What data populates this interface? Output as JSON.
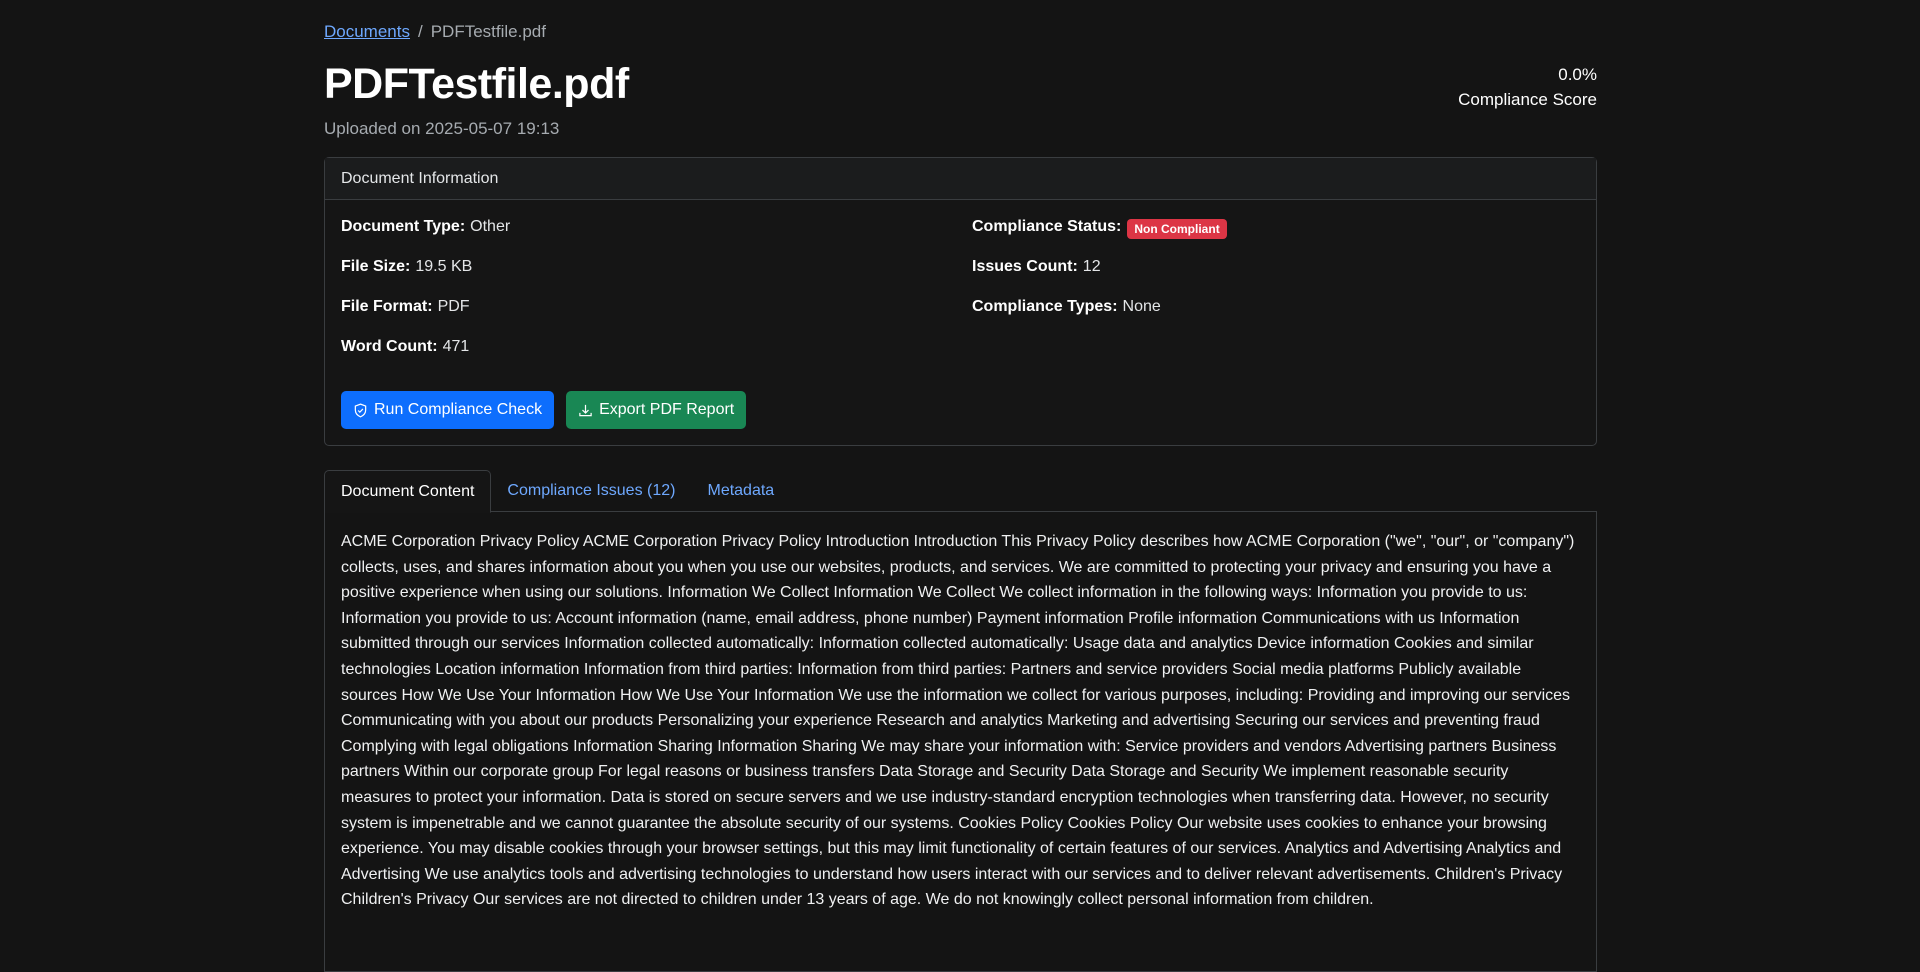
{
  "breadcrumb": {
    "parent": "Documents",
    "separator": "/",
    "current": "PDFTestfile.pdf"
  },
  "document": {
    "title": "PDFTestfile.pdf",
    "uploaded": "Uploaded on 2025-05-07 19:13"
  },
  "score": {
    "value": "0.0%",
    "label": "Compliance Score"
  },
  "info_card": {
    "header": "Document Information",
    "left": [
      {
        "label": "Document Type:",
        "value": "Other"
      },
      {
        "label": "File Size:",
        "value": "19.5 KB"
      },
      {
        "label": "File Format:",
        "value": "PDF"
      },
      {
        "label": "Word Count:",
        "value": "471"
      }
    ],
    "right": [
      {
        "label": "Compliance Status:",
        "value": "Non Compliant"
      },
      {
        "label": "Issues Count:",
        "value": "12"
      },
      {
        "label": "Compliance Types:",
        "value": "None"
      }
    ],
    "status_color": "#dc3545"
  },
  "actions": {
    "run_check": "Run Compliance Check",
    "run_check_icon": "shield-check-icon",
    "export": "Export PDF Report",
    "export_icon": "download-icon"
  },
  "tabs": [
    {
      "label": "Document Content",
      "active": true
    },
    {
      "label": "Compliance Issues (12)",
      "active": false
    },
    {
      "label": "Metadata",
      "active": false
    }
  ],
  "content_text": "ACME Corporation Privacy Policy ACME Corporation Privacy Policy Introduction Introduction This Privacy Policy describes how ACME Corporation (\"we\", \"our\", or \"company\") collects, uses, and shares information about you when you use our websites, products, and services. We are committed to protecting your privacy and ensuring you have a positive experience when using our solutions. Information We Collect Information We Collect We collect information in the following ways: Information you provide to us: Information you provide to us: Account information (name, email address, phone number) Payment information Profile information Communications with us Information submitted through our services Information collected automatically: Information collected automatically: Usage data and analytics Device information Cookies and similar technologies Location information Information from third parties: Information from third parties: Partners and service providers Social media platforms Publicly available sources How We Use Your Information How We Use Your Information We use the information we collect for various purposes, including: Providing and improving our services Communicating with you about our products Personalizing your experience Research and analytics Marketing and advertising Securing our services and preventing fraud Complying with legal obligations Information Sharing Information Sharing We may share your information with: Service providers and vendors Advertising partners Business partners Within our corporate group For legal reasons or business transfers Data Storage and Security Data Storage and Security We implement reasonable security measures to protect your information. Data is stored on secure servers and we use industry-standard encryption technologies when transferring data. However, no security system is impenetrable and we cannot guarantee the absolute security of our systems. Cookies Policy Cookies Policy Our website uses cookies to enhance your browsing experience. You may disable cookies through your browser settings, but this may limit functionality of certain features of our services. Analytics and Advertising Analytics and Advertising We use analytics tools and advertising technologies to understand how users interact with our services and to deliver relevant advertisements. Children's Privacy Children's Privacy Our services are not directed to children under 13 years of age. We do not knowingly collect personal information from children."
}
